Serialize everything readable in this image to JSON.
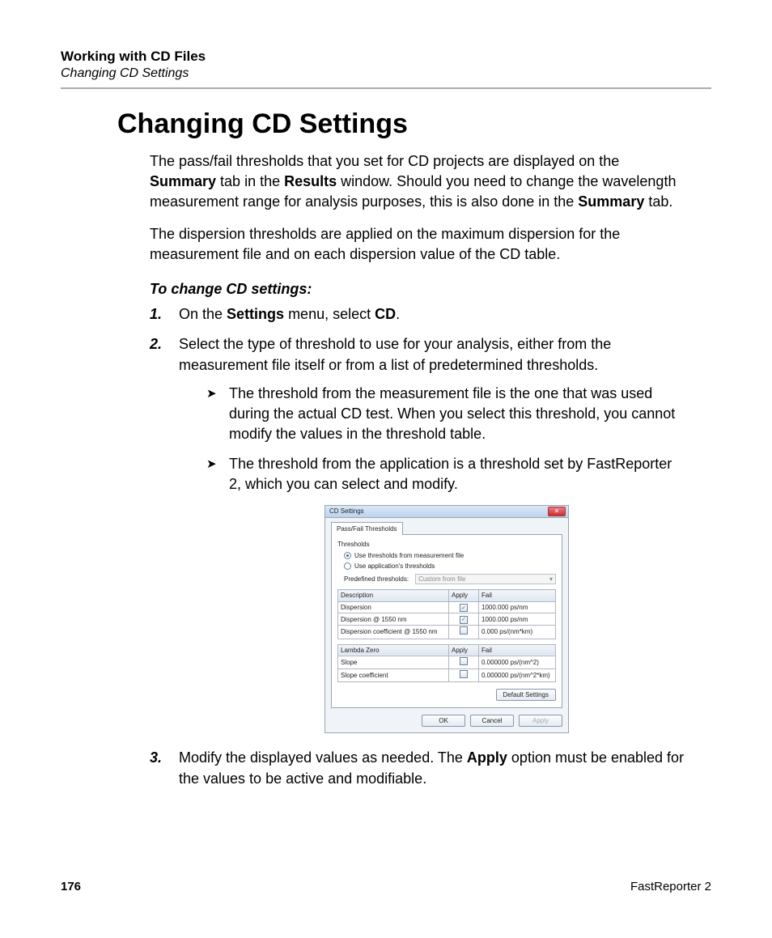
{
  "header": {
    "chapter": "Working with CD Files",
    "section": "Changing CD Settings"
  },
  "title": "Changing CD Settings",
  "para1": {
    "a": "The pass/fail thresholds that you set for CD projects are displayed on the ",
    "b1": "Summary",
    "c": " tab in the ",
    "b2": "Results",
    "d": " window. Should you need to change the wavelength measurement range for analysis purposes, this is also done in the ",
    "b3": "Summary",
    "e": " tab."
  },
  "para2": "The dispersion thresholds are applied on the maximum dispersion for the measurement file and on each dispersion value of the CD table.",
  "subhead": "To change CD settings:",
  "steps": {
    "s1": {
      "num": "1.",
      "a": "On the ",
      "b1": "Settings",
      "b": " menu, select ",
      "b2": "CD",
      "c": "."
    },
    "s2": {
      "num": "2.",
      "text": "Select the type of threshold to use for your analysis, either from the measurement file itself or from a list of predetermined thresholds."
    },
    "s2sub": {
      "a": "The threshold from the measurement file is the one that was used during the actual CD test. When you select this threshold, you cannot modify the values in the threshold table.",
      "b": "The threshold from the application is a threshold set by FastReporter 2, which you can select and modify."
    },
    "s3": {
      "num": "3.",
      "a": "Modify the displayed values as needed. The ",
      "b1": "Apply",
      "c": " option must be enabled for the values to be active and modifiable."
    }
  },
  "dialog": {
    "title": "CD Settings",
    "tab": "Pass/Fail Thresholds",
    "legend": "Thresholds",
    "radio1": "Use thresholds from measurement file",
    "radio2": "Use application's thresholds",
    "predef_label": "Predefined thresholds:",
    "predef_value": "Custom from file",
    "table1": {
      "h1": "Description",
      "h2": "Apply",
      "h3": "Fail",
      "r1c1": "Dispersion",
      "r1c3": "1000.000 ps/nm",
      "r2c1": "Dispersion @ 1550 nm",
      "r2c3": "1000.000 ps/nm",
      "r3c1": "Dispersion coefficient @ 1550 nm",
      "r3c3": "0.000 ps/(nm*km)"
    },
    "table2": {
      "h1": "Lambda Zero",
      "h2": "Apply",
      "h3": "Fail",
      "r1c1": "Slope",
      "r1c3": "0.000000 ps/(nm^2)",
      "r2c1": "Slope coefficient",
      "r2c3": "0.000000 ps/(nm^2*km)"
    },
    "btn_default": "Default Settings",
    "btn_ok": "OK",
    "btn_cancel": "Cancel",
    "btn_apply": "Apply"
  },
  "footer": {
    "page": "176",
    "product": "FastReporter 2"
  }
}
